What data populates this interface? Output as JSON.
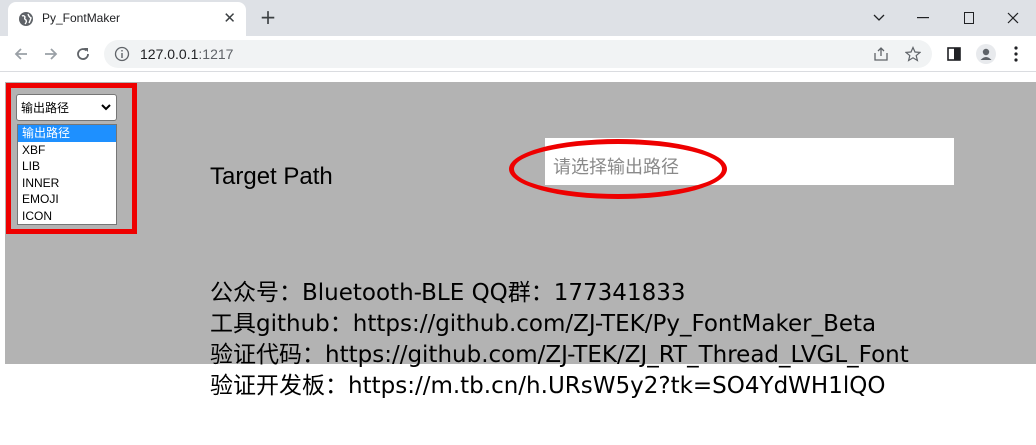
{
  "browser": {
    "tab": {
      "title": "Py_FontMaker",
      "favicon": "globe-icon"
    },
    "url_host": "127.0.0.1",
    "url_port": ":1217"
  },
  "page": {
    "select": {
      "value": "输出路径",
      "options": [
        "输出路径",
        "XBF",
        "LIB",
        "INNER",
        "EMOJI",
        "ICON"
      ]
    },
    "target_label": "Target Path",
    "path_placeholder": "请选择输出路径",
    "info": [
      "公众号：Bluetooth-BLE  QQ群：177341833",
      "工具github：https://github.com/ZJ-TEK/Py_FontMaker_Beta",
      "验证代码：https://github.com/ZJ-TEK/ZJ_RT_Thread_LVGL_Font",
      "验证开发板：https://m.tb.cn/h.URsW5y2?tk=SO4YdWH1lQO"
    ]
  },
  "colors": {
    "panel": "#b3b3b3",
    "highlight": "#ee0000",
    "selected_option": "#1e90ff"
  }
}
